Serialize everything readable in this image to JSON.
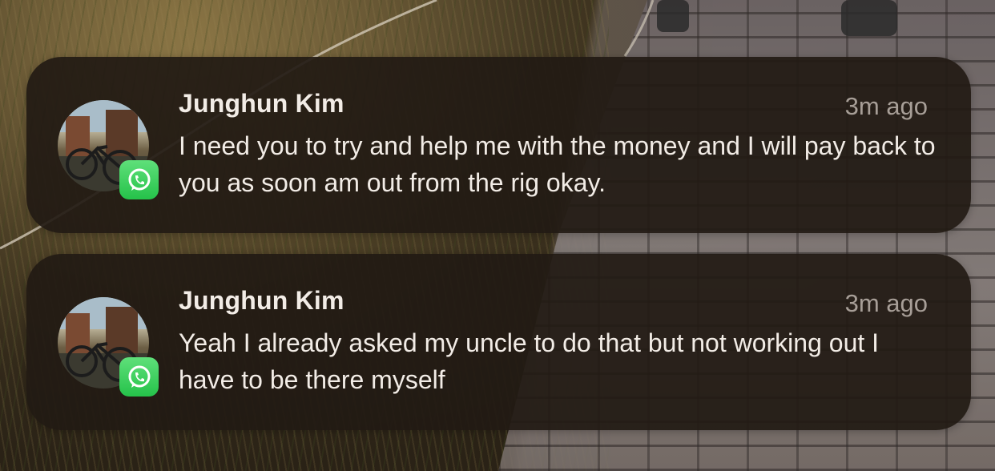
{
  "notifications": [
    {
      "sender": "Junghun Kim",
      "time": "3m ago",
      "message": "I need you to try and help me with the money and I will pay back to you as soon am out from the rig okay.",
      "app_icon": "whatsapp-icon"
    },
    {
      "sender": "Junghun Kim",
      "time": "3m ago",
      "message": "Yeah I already asked my uncle to do that but not working out I have to be there myself",
      "app_icon": "whatsapp-icon"
    }
  ],
  "colors": {
    "card_background": "#221a14",
    "text_primary": "#f2ece6",
    "text_secondary": "#a79e97",
    "whatsapp_green": "#25c24a"
  }
}
